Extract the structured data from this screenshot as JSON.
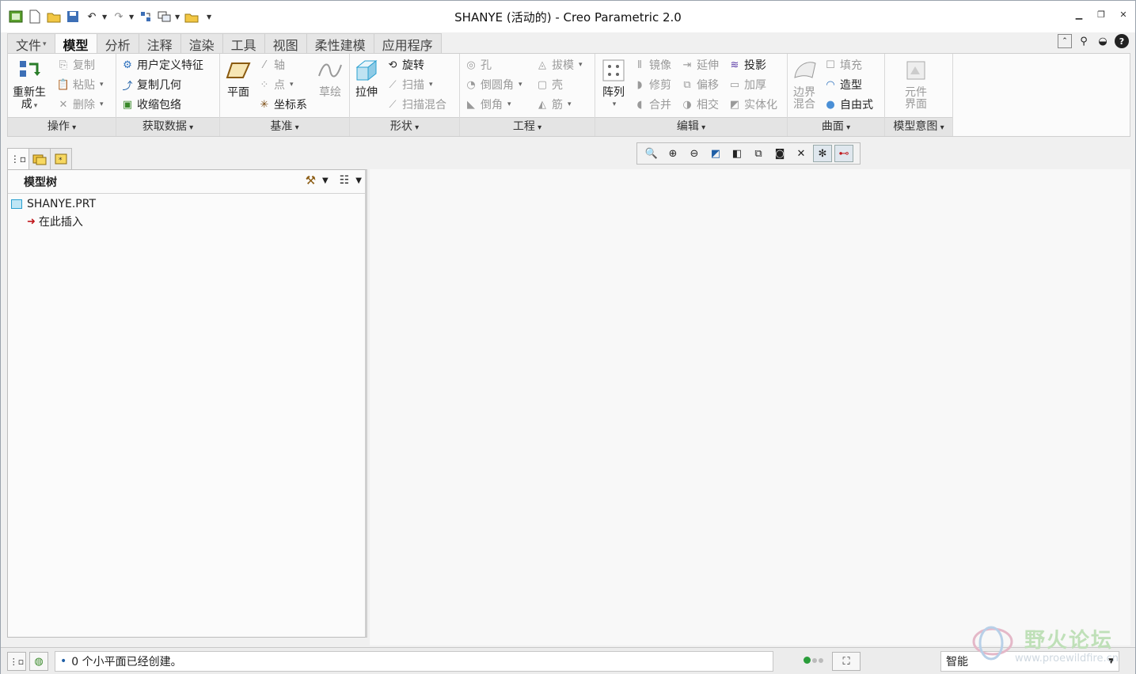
{
  "window": {
    "title": "SHANYE (活动的) - Creo Parametric 2.0"
  },
  "tabs": [
    {
      "label": "文件",
      "has_dropdown": true
    },
    {
      "label": "模型",
      "active": true
    },
    {
      "label": "分析"
    },
    {
      "label": "注释"
    },
    {
      "label": "渲染"
    },
    {
      "label": "工具"
    },
    {
      "label": "视图"
    },
    {
      "label": "柔性建模"
    },
    {
      "label": "应用程序"
    }
  ],
  "ribbon": {
    "operations": {
      "label": "操作",
      "regenerate": "重新生",
      "regenerate2": "成",
      "copy": "复制",
      "paste": "粘贴",
      "delete": "删除"
    },
    "get_data": {
      "label": "获取数据",
      "udf": "用户定义特征",
      "copy_geom": "复制几何",
      "shrinkwrap": "收缩包络"
    },
    "datum": {
      "label": "基准",
      "plane": "平面",
      "axis": "轴",
      "point": "点",
      "csys": "坐标系",
      "sketch": "草绘"
    },
    "shapes": {
      "label": "形状",
      "extrude": "拉伸",
      "revolve": "旋转",
      "sweep": "扫描",
      "swept_blend": "扫描混合"
    },
    "engineering": {
      "label": "工程",
      "hole": "孔",
      "round": "倒圆角",
      "chamfer": "倒角",
      "draft": "拔模",
      "shell": "壳",
      "rib": "筋"
    },
    "editing": {
      "label": "编辑",
      "pattern": "阵列",
      "mirror": "镜像",
      "trim": "修剪",
      "merge": "合并",
      "extend": "延伸",
      "offset": "偏移",
      "intersect": "相交",
      "project": "投影",
      "thicken": "加厚",
      "solidify": "实体化"
    },
    "surfaces": {
      "label": "曲面",
      "boundary": "边界",
      "boundary2": "混合",
      "fill": "填充",
      "style": "造型",
      "freestyle": "自由式"
    },
    "model_intent": {
      "label": "模型意图",
      "component": "元件",
      "component2": "界面"
    }
  },
  "model_tree": {
    "header": "模型树",
    "part": "SHANYE.PRT",
    "insert_here": "在此插入"
  },
  "status": {
    "message": "0 个小平面已经创建。",
    "filter": "智能"
  },
  "watermark": {
    "text": "野火论坛",
    "url": "www.proewildfire.cn"
  },
  "colors": {
    "accent": "#1f5fa6",
    "insert_arrow": "#c0161b",
    "status_dot": "#2a9d3a"
  }
}
